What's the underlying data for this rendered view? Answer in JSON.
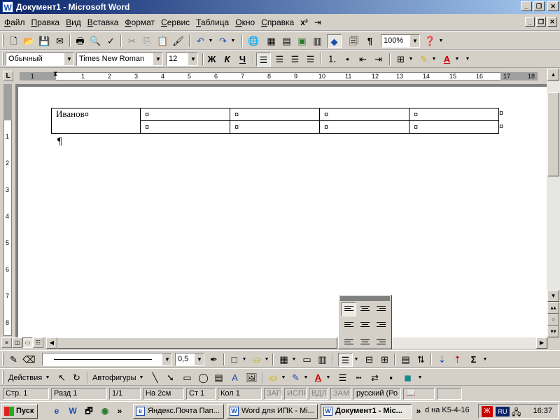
{
  "window": {
    "title": "Документ1 - Microsoft Word",
    "app_icon": "W",
    "buttons": [
      "_",
      "❐",
      "✕"
    ],
    "mdi_buttons": [
      "_",
      "❐",
      "✕"
    ]
  },
  "menu": {
    "items": [
      "Файл",
      "Правка",
      "Вид",
      "Вставка",
      "Формат",
      "Сервис",
      "Таблица",
      "Окно",
      "Справка"
    ],
    "extra_glyphs": [
      "x²",
      "⇥"
    ]
  },
  "standard_toolbar": {
    "zoom": "100%",
    "pilcrow": "¶"
  },
  "formatting_toolbar": {
    "style": "Обычный",
    "font": "Times New Roman",
    "size": "12",
    "bold": "Ж",
    "italic": "К",
    "underline": "Ч"
  },
  "ruler": {
    "h_numbers": [
      "1",
      "1",
      "2",
      "3",
      "4",
      "5",
      "6",
      "7",
      "8",
      "9",
      "10",
      "11",
      "12",
      "13",
      "14",
      "15",
      "16",
      "17",
      "18"
    ],
    "v_numbers": [
      "1",
      "2",
      "3",
      "4",
      "5",
      "6",
      "7",
      "8"
    ],
    "tab_selector": "L"
  },
  "document": {
    "table": {
      "rows": [
        [
          "Иванов",
          "",
          "",
          "",
          ""
        ],
        [
          "",
          "",
          "",
          "",
          ""
        ]
      ],
      "cell_marker": "¤"
    },
    "paragraph_mark": "¶"
  },
  "tables_toolbar": {
    "line_weight": "0,5"
  },
  "drawing_toolbar": {
    "actions": "Действия",
    "autoshapes": "Автофигуры"
  },
  "status": {
    "page": "Стр. 1",
    "section": "Разд 1",
    "pages": "1/1",
    "at": "На 2см",
    "line": "Ст 1",
    "col": "Кол 1",
    "rec": "ЗАП",
    "trk": "ИСПР",
    "ext": "ВДЛ",
    "ovr": "ЗАМ",
    "language": "русский (Ро"
  },
  "taskbar": {
    "start": "Пуск",
    "chevron": "»",
    "tasks": [
      {
        "label": "Яндекс.Почта Пап...",
        "active": false
      },
      {
        "label": "Word для  ИПК - Mi...",
        "active": false
      },
      {
        "label": "Документ1 - Mic...",
        "active": true
      },
      {
        "label": "d на K5-4-16",
        "active": false
      }
    ],
    "language": "RU",
    "clock": "16:37"
  }
}
